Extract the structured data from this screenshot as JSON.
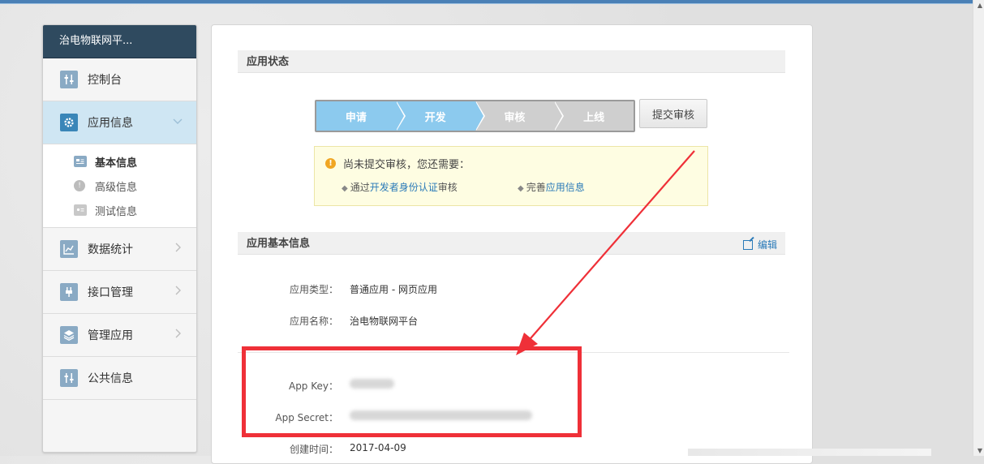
{
  "sidebar": {
    "title": "治电物联网平...",
    "items": [
      {
        "label": "控制台",
        "icon": "dashboard-icon"
      },
      {
        "label": "应用信息",
        "icon": "gear-icon"
      },
      {
        "label": "数据统计",
        "icon": "chart-icon"
      },
      {
        "label": "接口管理",
        "icon": "plug-icon"
      },
      {
        "label": "管理应用",
        "icon": "layers-icon"
      },
      {
        "label": "公共信息",
        "icon": "dashboard-icon"
      }
    ],
    "sub_items": [
      {
        "label": "基本信息",
        "icon": "card-icon"
      },
      {
        "label": "高级信息",
        "icon": "info-icon"
      },
      {
        "label": "测试信息",
        "icon": "id-card-icon"
      }
    ]
  },
  "status_section": {
    "title": "应用状态",
    "steps": [
      {
        "label": "申请",
        "state": "done"
      },
      {
        "label": "开发",
        "state": "done"
      },
      {
        "label": "审核",
        "state": "pending"
      },
      {
        "label": "上线",
        "state": "pending"
      }
    ],
    "submit_label": "提交审核"
  },
  "notice": {
    "title": "尚未提交审核，您还需要：",
    "item1_pre": "通过",
    "item1_link": "开发者身份认证",
    "item1_post": "审核",
    "item2_pre": "完善",
    "item2_link": "应用信息"
  },
  "basic_section": {
    "title": "应用基本信息",
    "edit_label": "编辑",
    "fields": {
      "type_label": "应用类型：",
      "type_value": "普通应用 - 网页应用",
      "name_label": "应用名称：",
      "name_value": "治电物联网平台",
      "key_label": "App Key：",
      "secret_label": "App Secret：",
      "created_label": "创建时间：",
      "created_value": "2017-04-09"
    }
  },
  "colors": {
    "sidebar_header": "#2f4a5f",
    "step_done": "#8ccaee",
    "step_pending": "#cfcfcf",
    "annotation_red": "#ef3038",
    "link": "#2a7ab8"
  }
}
